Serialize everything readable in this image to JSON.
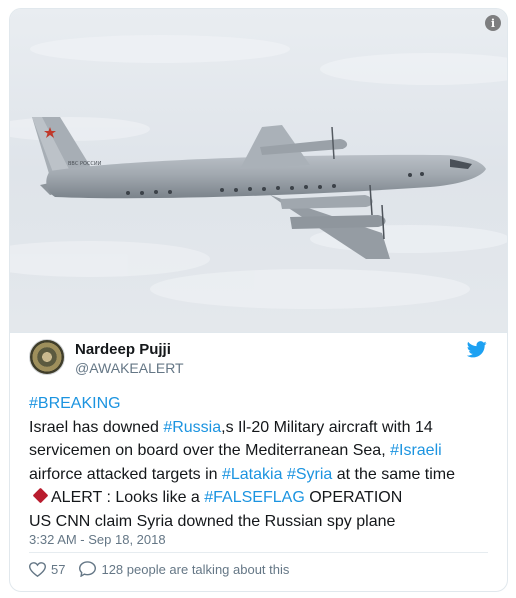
{
  "media": {
    "info_icon": "info-icon",
    "aircraft_marking": "ВВС РОССИИ"
  },
  "author": {
    "display_name": "Nardeep Pujji",
    "handle": "@AWAKEALERT",
    "avatar_icon": "spiral-avatar"
  },
  "platform_icon": "twitter-bird-icon",
  "tweet": {
    "hashtag_breaking": "#BREAKING",
    "l2_a": "Israel has downed ",
    "l2_tag": "#Russia",
    "l2_b": ",s Il-20 Military aircraft with 14",
    "l3_a": "servicemen on board over the Mediterranean Sea, ",
    "l3_tag": "#Israeli",
    "l4_a": "airforce attacked targets in ",
    "l4_tag1": "#Latakia",
    "l4_sp": " ",
    "l4_tag2": "#Syria",
    "l4_b": " at the same time",
    "l5_a": "ALERT : Looks like a ",
    "l5_tag": "#FALSEFLAG",
    "l5_b": " OPERATION",
    "l6": "US CNN claim Syria downed the Russian spy plane"
  },
  "timestamp": "3:32 AM - Sep 18, 2018",
  "actions": {
    "like_count": "57",
    "talking_text": "128 people are talking about this"
  },
  "colors": {
    "link": "#1c94e0",
    "twitter_blue": "#1da1f2",
    "muted": "#657786",
    "diamond": "#b91c2e"
  }
}
